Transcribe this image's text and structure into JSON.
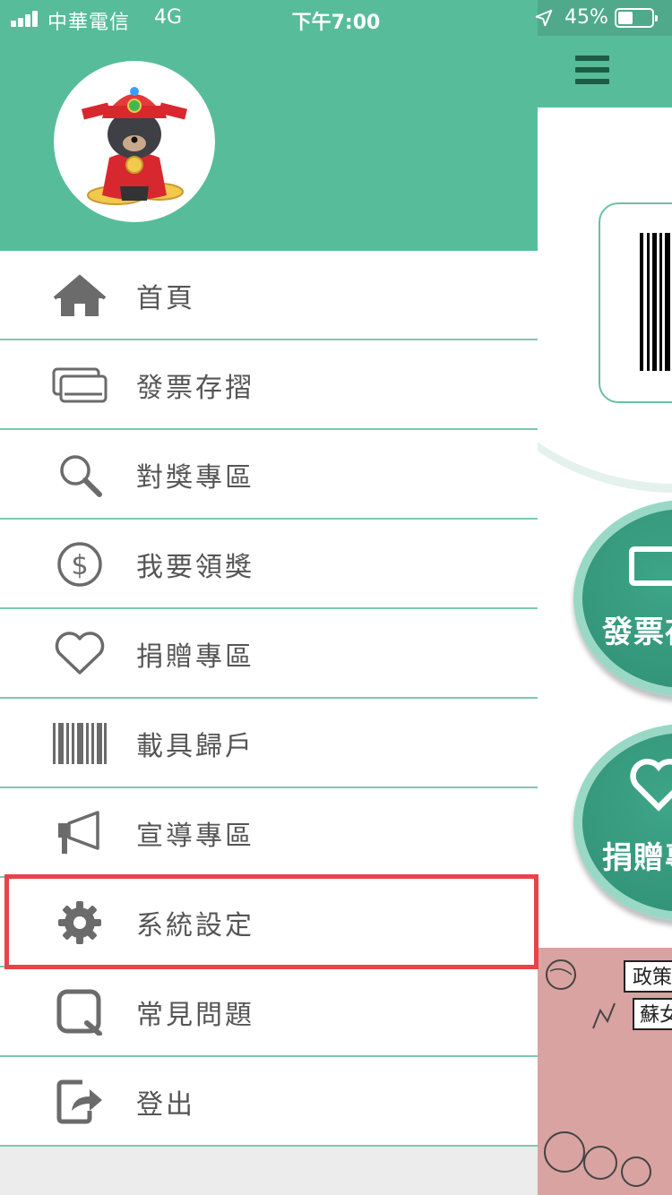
{
  "status_bar": {
    "carrier": "中華電信",
    "network": "4G",
    "time": "下午7:00",
    "battery_percent": "45%",
    "battery_level": 0.45
  },
  "background_app": {
    "menu_icon": "hamburger-icon",
    "action_buttons": [
      {
        "label": "發票存",
        "icon": "invoice-icon"
      },
      {
        "label": "捐贈專",
        "icon": "heart-icon"
      }
    ],
    "banner_text": [
      "政策",
      "蘇女"
    ]
  },
  "drawer": {
    "avatar_icon": "mascot-bear-icon",
    "items": [
      {
        "label": "首頁",
        "icon": "home-icon"
      },
      {
        "label": "發票存摺",
        "icon": "cards-icon"
      },
      {
        "label": "對獎專區",
        "icon": "search-icon"
      },
      {
        "label": "我要領獎",
        "icon": "dollar-icon"
      },
      {
        "label": "捐贈專區",
        "icon": "heart-icon"
      },
      {
        "label": "載具歸戶",
        "icon": "barcode-icon"
      },
      {
        "label": "宣導專區",
        "icon": "megaphone-icon"
      },
      {
        "label": "系統設定",
        "icon": "gear-icon"
      },
      {
        "label": "常見問題",
        "icon": "question-icon"
      },
      {
        "label": "登出",
        "icon": "logout-icon"
      }
    ],
    "highlighted_item": "系統設定"
  },
  "colors": {
    "header_green": "#57bc9a",
    "divider": "#7cc9ae",
    "highlight": "#e8434a",
    "icon_gray": "#6b6b6b"
  }
}
